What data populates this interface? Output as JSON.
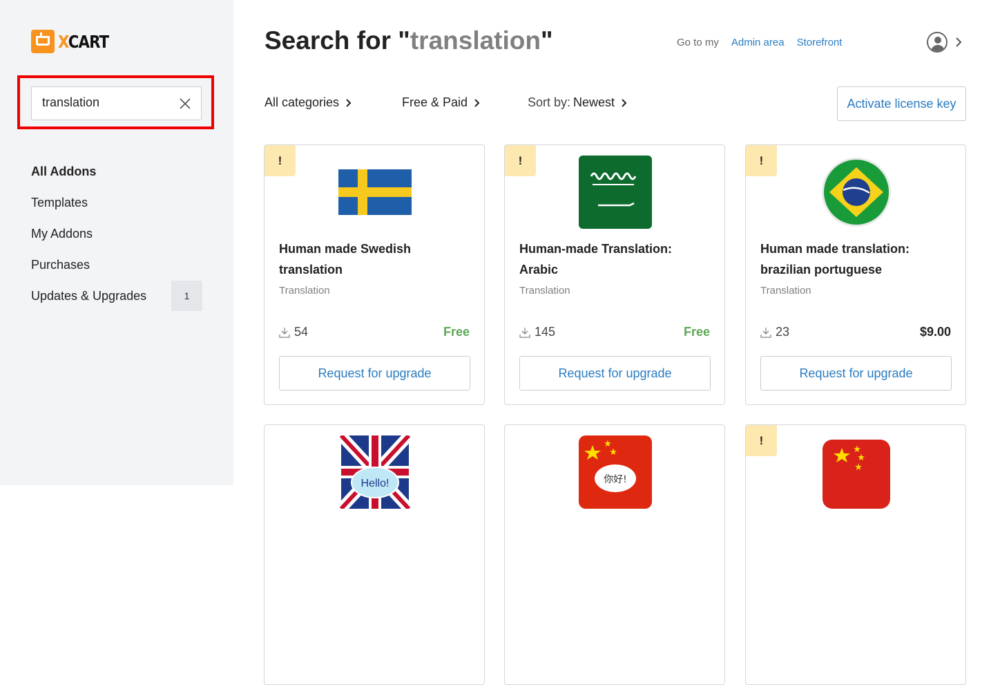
{
  "sidebar": {
    "logo_text": "XCART",
    "search": {
      "value": "translation",
      "placeholder": ""
    },
    "items": [
      {
        "label": "All Addons",
        "active": true
      },
      {
        "label": "Templates"
      },
      {
        "label": "My Addons"
      },
      {
        "label": "Purchases"
      },
      {
        "label": "Updates & Upgrades",
        "count": "1"
      }
    ]
  },
  "header": {
    "title_prefix": "Search for \"",
    "title_term": "translation",
    "title_suffix": "\"",
    "go_to": "Go to my",
    "admin_link": "Admin area",
    "storefront_link": "Storefront"
  },
  "filters": {
    "categories": "All categories",
    "pricing": "Free & Paid",
    "sort_label": "Sort by:",
    "sort_value": "Newest"
  },
  "license_button": "Activate license key",
  "cards": [
    {
      "badge": "!",
      "name": "Human made Swedish translation",
      "category": "Translation",
      "downloads": "54",
      "price": "Free",
      "button": "Request for upgrade",
      "flag": "sweden"
    },
    {
      "badge": "!",
      "name": "Human-made Translation: Arabic",
      "category": "Translation",
      "downloads": "145",
      "price": "Free",
      "button": "Request for upgrade",
      "flag": "saudi-arabia"
    },
    {
      "badge": "!",
      "name": "Human made translation: brazilian portuguese",
      "category": "Translation",
      "downloads": "23",
      "price": "$9.00",
      "button": "Request for upgrade",
      "flag": "brazil"
    },
    {
      "flag": "uk",
      "bubble_text": "Hello!"
    },
    {
      "flag": "china",
      "bubble_text": "你好!"
    },
    {
      "badge": "!",
      "flag": "china"
    }
  ],
  "colors": {
    "accent": "#2a7cc2",
    "free": "#5fa859",
    "logo": "#f7931e",
    "highlight": "#ef0000",
    "badge_bg": "#fde8b0"
  }
}
